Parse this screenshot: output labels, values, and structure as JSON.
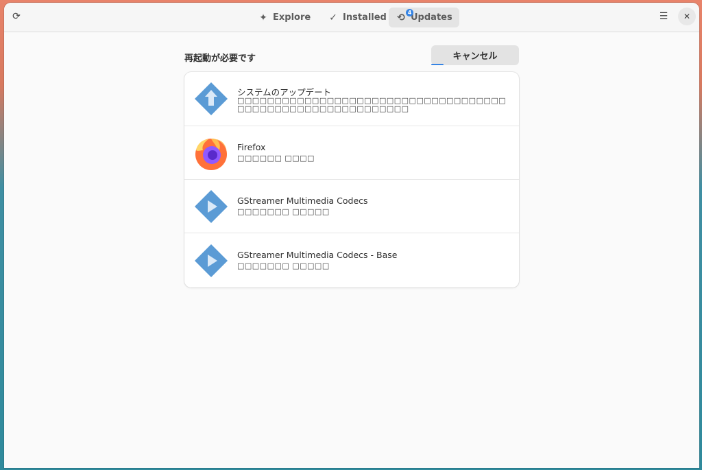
{
  "header": {
    "tabs": [
      {
        "label": "Explore",
        "icon": "explore-icon"
      },
      {
        "label": "Installed",
        "icon": "installed-icon"
      },
      {
        "label": "Updates",
        "icon": "updates-icon",
        "badge": "4",
        "active": true
      }
    ]
  },
  "main": {
    "section_title": "再起動が必要です",
    "cancel_label": "キャンセル",
    "updates": [
      {
        "name": "システムのアップデート",
        "description": "□□□□□□□□□□□□□□□□□□□□□□□□□□□□□□□□□□□□□□□□□□□□□□□□□□□□□□□□□□□",
        "icon": "system-update-icon"
      },
      {
        "name": "Firefox",
        "description": "□□□□□□ □□□□",
        "icon": "firefox-icon"
      },
      {
        "name": "GStreamer Multimedia Codecs",
        "description": "□□□□□□□ □□□□□",
        "icon": "gstreamer-icon"
      },
      {
        "name": "GStreamer Multimedia Codecs - Base",
        "description": "□□□□□□□ □□□□□",
        "icon": "gstreamer-icon"
      }
    ]
  },
  "colors": {
    "accent": "#3584e4",
    "app_icon_blue": "#5b9bd5"
  }
}
